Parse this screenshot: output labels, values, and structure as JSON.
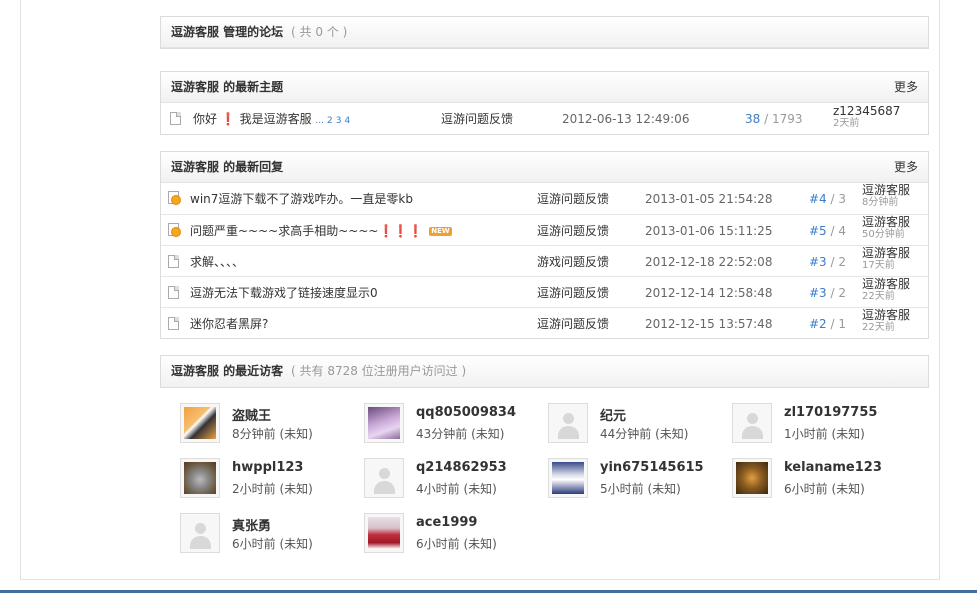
{
  "managed_forums": {
    "title": "逗游客服 管理的论坛",
    "count": "( 共 0 个 )"
  },
  "latest_threads": {
    "title": "逗游客服 的最新主题",
    "more": "更多",
    "rows": [
      {
        "title": "你好 ❗ 我是逗游客服",
        "pages_prefix": "...",
        "pages": [
          "2",
          "3",
          "4"
        ],
        "forum": "逗游问题反馈",
        "date": "2012-06-13 12:49:06",
        "replies": "38",
        "views": "1793",
        "last_user": "z12345687",
        "last_time": "2天前"
      }
    ]
  },
  "latest_replies": {
    "title": "逗游客服 的最新回复",
    "more": "更多",
    "rows": [
      {
        "title": "win7逗游下载不了游戏咋办。一直是零kb",
        "forum": "逗游问题反馈",
        "date": "2013-01-05 21:54:28",
        "floor": "#4",
        "total": "3",
        "last_user": "逗游客服",
        "last_time": "8分钟前",
        "icon": "hot"
      },
      {
        "title": "问题严重~~~~求高手相助~~~~❗❗❗",
        "badge": "NEW",
        "forum": "逗游问题反馈",
        "date": "2013-01-06 15:11:25",
        "floor": "#5",
        "total": "4",
        "last_user": "逗游客服",
        "last_time": "50分钟前",
        "icon": "hot"
      },
      {
        "title": "求解、、、、",
        "forum": "游戏问题反馈",
        "date": "2012-12-18 22:52:08",
        "floor": "#3",
        "total": "2",
        "last_user": "逗游客服",
        "last_time": "17天前",
        "icon": "doc"
      },
      {
        "title": "逗游无法下载游戏了链接速度显示0",
        "forum": "逗游问题反馈",
        "date": "2012-12-14 12:58:48",
        "floor": "#3",
        "total": "2",
        "last_user": "逗游客服",
        "last_time": "22天前",
        "icon": "doc"
      },
      {
        "title": "迷你忍者黑屏?",
        "forum": "逗游问题反馈",
        "date": "2012-12-15 13:57:48",
        "floor": "#2",
        "total": "1",
        "last_user": "逗游客服",
        "last_time": "22天前",
        "icon": "doc"
      }
    ]
  },
  "recent_visitors": {
    "title": "逗游客服 的最近访客",
    "count": "( 共有 8728 位注册用户访问过 )",
    "items": [
      {
        "name": "盗贼王",
        "time": "8分钟前 (未知)",
        "avatar": "photo-orange"
      },
      {
        "name": "qq805009834",
        "time": "43分钟前 (未知)",
        "avatar": "photo-purple"
      },
      {
        "name": "纪元",
        "time": "44分钟前 (未知)",
        "avatar": "default"
      },
      {
        "name": "zl170197755",
        "time": "1小时前 (未知)",
        "avatar": "default"
      },
      {
        "name": "hwppl123",
        "time": "2小时前 (未知)",
        "avatar": "photo-koala"
      },
      {
        "name": "q214862953",
        "time": "4小时前 (未知)",
        "avatar": "default"
      },
      {
        "name": "yin675145615",
        "time": "5小时前 (未知)",
        "avatar": "photo-blue"
      },
      {
        "name": "kelaname123",
        "time": "6小时前 (未知)",
        "avatar": "photo-brown"
      },
      {
        "name": "真张勇",
        "time": "6小时前 (未知)",
        "avatar": "default"
      },
      {
        "name": "ace1999",
        "time": "6小时前 (未知)",
        "avatar": "photo-red"
      }
    ]
  },
  "colors": {
    "link_blue": "#3a7cc7",
    "bottom_bar": "#3f6f9d"
  }
}
